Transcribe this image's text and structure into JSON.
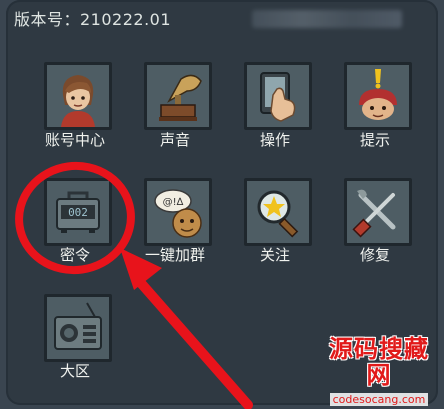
{
  "header": {
    "version_label": "版本号：210222.01"
  },
  "menu": {
    "items": [
      {
        "label": "账号中心",
        "icon": "avatar-icon"
      },
      {
        "label": "声音",
        "icon": "gramophone-icon"
      },
      {
        "label": "操作",
        "icon": "hand-tablet-icon"
      },
      {
        "label": "提示",
        "icon": "hint-head-icon"
      },
      {
        "label": "密令",
        "icon": "code-lock-box-icon"
      },
      {
        "label": "一键加群",
        "icon": "chat-bubble-icon"
      },
      {
        "label": "关注",
        "icon": "magnifier-star-icon"
      },
      {
        "label": "修复",
        "icon": "repair-tools-icon"
      },
      {
        "label": "大区",
        "icon": "radio-icon"
      }
    ]
  },
  "annotation": {
    "color": "#e8131b",
    "highlighted_item": "密令"
  },
  "watermark": {
    "title": "源码搜藏网",
    "url": "codesocang.com"
  }
}
